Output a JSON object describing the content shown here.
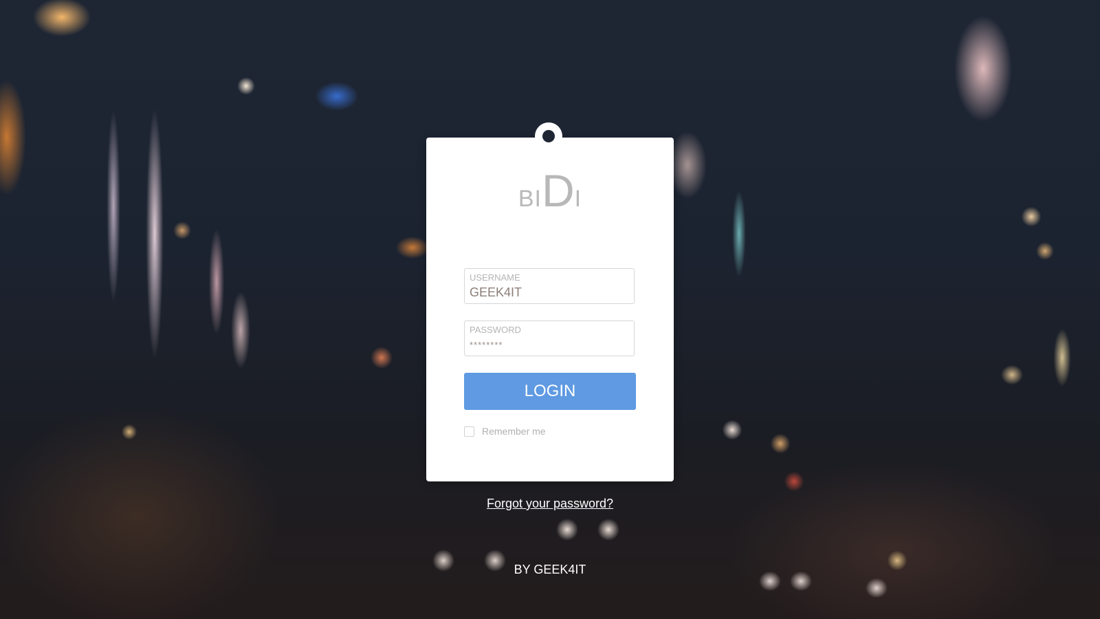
{
  "logo": {
    "prefix": "BI",
    "main": "D",
    "suffix": "I"
  },
  "form": {
    "username": {
      "label": "USERNAME",
      "value": "GEEK4IT"
    },
    "password": {
      "label": "PASSWORD",
      "value": "********"
    },
    "login_label": "LOGIN",
    "remember_label": "Remember me",
    "remember_checked": false
  },
  "links": {
    "forgot_password": "Forgot your password?"
  },
  "footer": {
    "credit": "BY GEEK4IT"
  },
  "colors": {
    "accent": "#5f9ae2",
    "card": "#ffffff",
    "background": "#1e2634"
  }
}
